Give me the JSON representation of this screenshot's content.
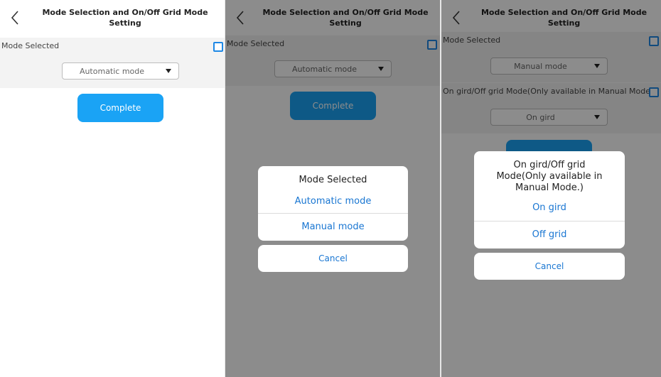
{
  "header": {
    "title": "Mode Selection and On/Off Grid Mode Setting"
  },
  "mode_row": {
    "label": "Mode Selected"
  },
  "grid_row": {
    "label": "On gird/Off grid Mode(Only available in Manual Mode.)"
  },
  "screens": [
    {
      "mode_value": "Automatic mode",
      "complete_label": "Complete"
    },
    {
      "mode_value": "Automatic mode",
      "complete_label": "Complete"
    },
    {
      "mode_value": "Manual mode",
      "grid_value": "On gird"
    }
  ],
  "mode_sheet": {
    "title": "Mode Selected",
    "options": [
      "Automatic mode",
      "Manual mode"
    ],
    "cancel": "Cancel"
  },
  "grid_sheet": {
    "title": "On gird/Off grid Mode(Only available in Manual Mode.)",
    "options": [
      "On gird",
      "Off grid"
    ],
    "cancel": "Cancel"
  },
  "icons": {
    "back": "chevron-left-icon",
    "dropdown": "caret-down-icon",
    "checkbox": "checkbox-icon"
  },
  "colors": {
    "accent": "#1aa3f5",
    "link": "#1976d2",
    "checkbox": "#1e88e5",
    "overlay": "rgba(0,0,0,0.45)"
  }
}
